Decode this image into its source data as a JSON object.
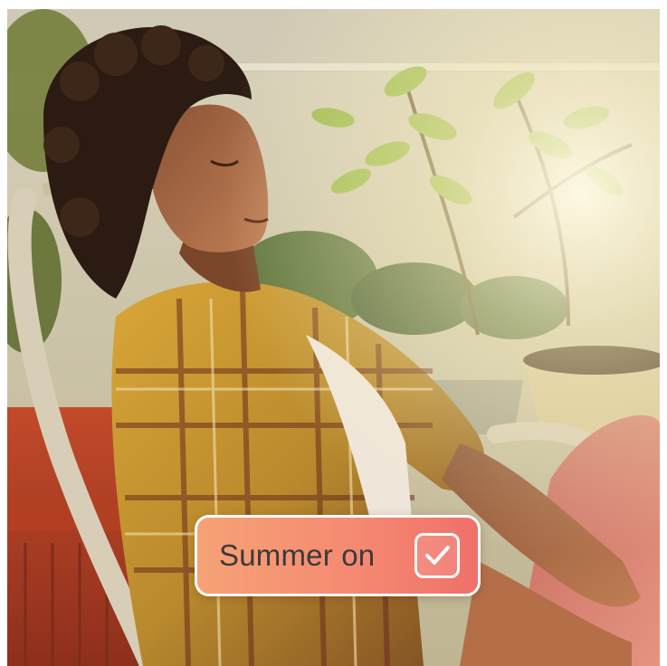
{
  "photo": {
    "subject": "woman-relaxing-in-chair",
    "icon": "photo-image"
  },
  "badge": {
    "label": "Summer on",
    "checked": true,
    "icon": "checkmark-icon",
    "colors": {
      "gradient_start": "#f6a276",
      "gradient_end": "#f0706a",
      "text": "#3b3a3a",
      "border": "#ffffff"
    }
  }
}
